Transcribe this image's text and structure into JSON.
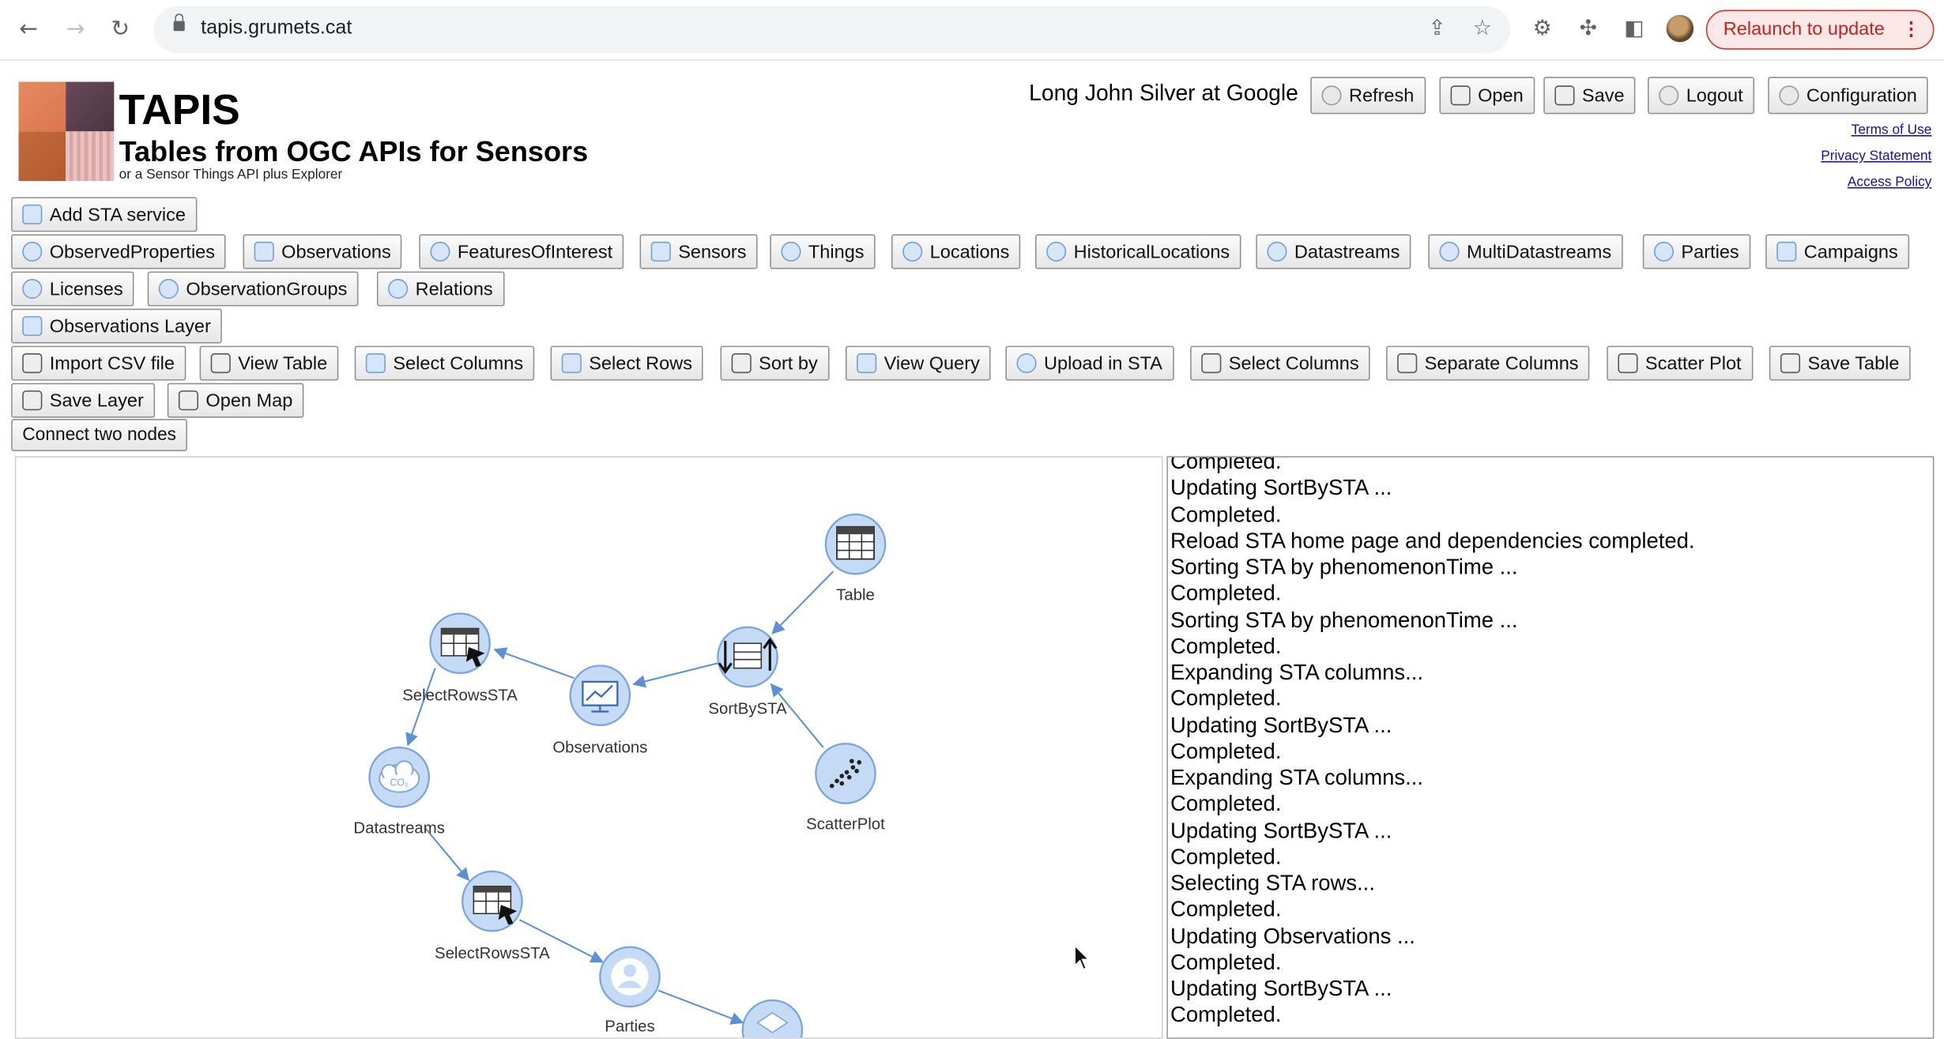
{
  "browser": {
    "url": "tapis.grumets.cat",
    "relaunch_label": "Relaunch to update",
    "menu_glyph": "⋮"
  },
  "header": {
    "title": "TAPIS",
    "subtitle": "Tables from OGC APIs for Sensors",
    "tagline": "or a Sensor Things API plus Explorer",
    "user": "Long John Silver at Google",
    "refresh": "Refresh",
    "open": "Open",
    "save": "Save",
    "logout": "Logout",
    "configuration": "Configuration",
    "terms": "Terms of Use",
    "privacy": "Privacy Statement",
    "access": "Access Policy"
  },
  "toolbar": {
    "add_sta": "Add STA service",
    "observed_properties": "ObservedProperties",
    "observations": "Observations",
    "features_of_interest": "FeaturesOfInterest",
    "sensors": "Sensors",
    "things": "Things",
    "locations": "Locations",
    "historical_locations": "HistoricalLocations",
    "datastreams": "Datastreams",
    "multidatastreams": "MultiDatastreams",
    "parties": "Parties",
    "campaigns": "Campaigns",
    "licenses": "Licenses",
    "observation_groups": "ObservationGroups",
    "relations": "Relations",
    "observations_layer": "Observations Layer",
    "import_csv": "Import CSV file",
    "view_table": "View Table",
    "select_columns": "Select Columns",
    "select_rows": "Select Rows",
    "sort_by": "Sort by",
    "view_query": "View Query",
    "upload_sta": "Upload in STA",
    "select_columns_2": "Select Columns",
    "separate_columns": "Separate Columns",
    "scatter_plot": "Scatter Plot",
    "save_table": "Save Table",
    "save_layer": "Save Layer",
    "open_map": "Open Map",
    "connect_nodes": "Connect two nodes"
  },
  "graph": {
    "nodes": [
      {
        "label": "Table"
      },
      {
        "label": "SortBySTA"
      },
      {
        "label": "Observations"
      },
      {
        "label": "SelectRowsSTA"
      },
      {
        "label": "Datastreams"
      },
      {
        "label": "SelectRowsSTA"
      },
      {
        "label": "ScatterPlot"
      },
      {
        "label": "Parties"
      }
    ]
  },
  "log": [
    "Completed.",
    "Updating SortBySTA ...",
    "Completed.",
    "Reload STA home page and dependencies completed.",
    "Sorting STA by phenomenonTime ...",
    "Completed.",
    "Sorting STA by phenomenonTime ...",
    "Completed.",
    "Expanding STA columns...",
    "Completed.",
    "Updating SortBySTA ...",
    "Completed.",
    "Expanding STA columns...",
    "Completed.",
    "Updating SortBySTA ...",
    "Completed.",
    "Selecting STA rows...",
    "Completed.",
    "Updating Observations ...",
    "Completed.",
    "Updating SortBySTA ...",
    "Completed."
  ],
  "colors": {
    "node_fill": "#c5daf5",
    "node_stroke": "#7aa6e0",
    "edge": "#5b8fd6",
    "relaunch": "#c5221f"
  }
}
